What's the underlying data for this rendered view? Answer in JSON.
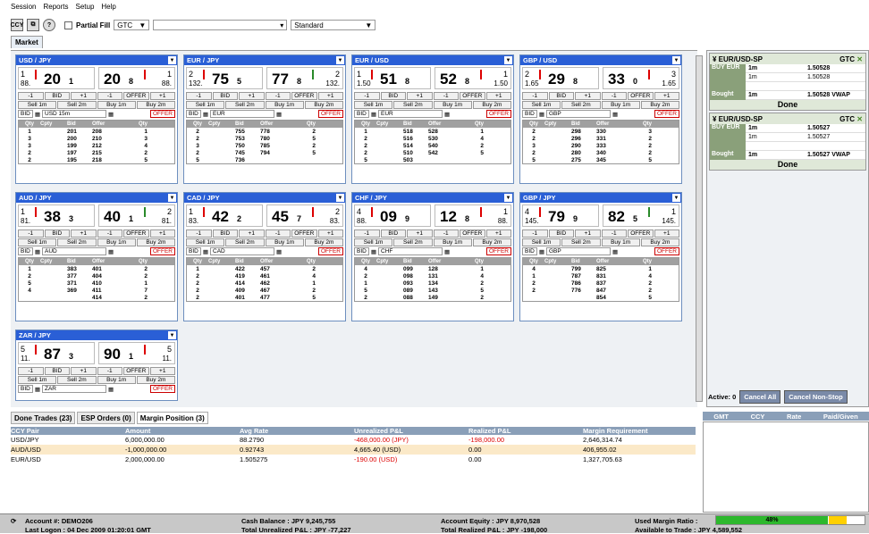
{
  "menu": [
    "Session",
    "Reports",
    "Setup",
    "Help"
  ],
  "toolbar": {
    "ccy_label": "CCY",
    "partial_fill": "Partial Fill",
    "tif": "GTC",
    "order_type": "Standard"
  },
  "main_tab": "Market",
  "panels": [
    {
      "pair": "USD / JPY",
      "bid_l": "1",
      "bid_big": "20",
      "bid_pip": "1",
      "bid_pre": "88.",
      "off_big": "20",
      "off_pip": "8",
      "off_r": "1",
      "off_pre": "88.",
      "ccy": "USD",
      "amount": "15m",
      "rows": [
        [
          "1",
          "201",
          "208",
          "1"
        ],
        [
          "3",
          "200",
          "210",
          "3"
        ],
        [
          "3",
          "199",
          "212",
          "4"
        ],
        [
          "2",
          "197",
          "215",
          "2"
        ],
        [
          "2",
          "195",
          "218",
          "5"
        ]
      ]
    },
    {
      "pair": "EUR / JPY",
      "bid_l": "2",
      "bid_big": "75",
      "bid_pip": "5",
      "bid_pre": "132.",
      "off_big": "77",
      "off_pip": "8",
      "off_r": "2",
      "off_pre": "132.",
      "ccy": "EUR",
      "amount": "",
      "rows": [
        [
          "2",
          "755",
          "778",
          "2"
        ],
        [
          "2",
          "753",
          "780",
          "5"
        ],
        [
          "3",
          "750",
          "785",
          "2"
        ],
        [
          "2",
          "745",
          "794",
          "5"
        ],
        [
          "5",
          "736",
          "",
          ""
        ]
      ]
    },
    {
      "pair": "EUR / USD",
      "bid_l": "1",
      "bid_big": "51",
      "bid_pip": "8",
      "bid_pre": "1.50",
      "off_big": "52",
      "off_pip": "8",
      "off_r": "1",
      "off_pre": "1.50",
      "ccy": "EUR",
      "amount": "",
      "rows": [
        [
          "1",
          "518",
          "528",
          "1"
        ],
        [
          "2",
          "516",
          "530",
          "4"
        ],
        [
          "2",
          "514",
          "540",
          "2"
        ],
        [
          "2",
          "510",
          "542",
          "5"
        ],
        [
          "5",
          "503",
          "",
          ""
        ]
      ]
    },
    {
      "pair": "GBP / USD",
      "bid_l": "2",
      "bid_big": "29",
      "bid_pip": "8",
      "bid_pre": "1.65",
      "off_big": "33",
      "off_pip": "0",
      "off_r": "3",
      "off_pre": "1.65",
      "ccy": "GBP",
      "amount": "",
      "rows": [
        [
          "2",
          "298",
          "330",
          "3"
        ],
        [
          "2",
          "296",
          "331",
          "2"
        ],
        [
          "3",
          "290",
          "333",
          "2"
        ],
        [
          "2",
          "280",
          "340",
          "2"
        ],
        [
          "5",
          "275",
          "345",
          "5"
        ]
      ]
    },
    {
      "pair": "AUD / JPY",
      "bid_l": "1",
      "bid_big": "38",
      "bid_pip": "3",
      "bid_pre": "81.",
      "off_big": "40",
      "off_pip": "1",
      "off_r": "2",
      "off_pre": "81.",
      "ccy": "AUD",
      "amount": "",
      "rows": [
        [
          "1",
          "383",
          "401",
          "2"
        ],
        [
          "2",
          "377",
          "404",
          "2"
        ],
        [
          "5",
          "371",
          "410",
          "1"
        ],
        [
          "4",
          "369",
          "411",
          "7"
        ],
        [
          "",
          "",
          "414",
          "2"
        ]
      ]
    },
    {
      "pair": "CAD / JPY",
      "bid_l": "1",
      "bid_big": "42",
      "bid_pip": "2",
      "bid_pre": "83.",
      "off_big": "45",
      "off_pip": "7",
      "off_r": "2",
      "off_pre": "83.",
      "ccy": "CAD",
      "amount": "",
      "rows": [
        [
          "1",
          "422",
          "457",
          "2"
        ],
        [
          "2",
          "419",
          "461",
          "4"
        ],
        [
          "2",
          "414",
          "462",
          "1"
        ],
        [
          "2",
          "409",
          "467",
          "2"
        ],
        [
          "2",
          "401",
          "477",
          "5"
        ]
      ]
    },
    {
      "pair": "CHF / JPY",
      "bid_l": "4",
      "bid_big": "09",
      "bid_pip": "9",
      "bid_pre": "88.",
      "off_big": "12",
      "off_pip": "8",
      "off_r": "1",
      "off_pre": "88.",
      "ccy": "CHF",
      "amount": "",
      "rows": [
        [
          "4",
          "099",
          "128",
          "1"
        ],
        [
          "2",
          "098",
          "131",
          "4"
        ],
        [
          "1",
          "093",
          "134",
          "2"
        ],
        [
          "5",
          "089",
          "143",
          "5"
        ],
        [
          "2",
          "088",
          "149",
          "2"
        ]
      ]
    },
    {
      "pair": "GBP / JPY",
      "bid_l": "4",
      "bid_big": "79",
      "bid_pip": "9",
      "bid_pre": "145.",
      "off_big": "82",
      "off_pip": "5",
      "off_r": "1",
      "off_pre": "145.",
      "ccy": "GBP",
      "amount": "",
      "rows": [
        [
          "4",
          "799",
          "825",
          "1"
        ],
        [
          "1",
          "787",
          "831",
          "4"
        ],
        [
          "2",
          "786",
          "837",
          "2"
        ],
        [
          "2",
          "776",
          "847",
          "2"
        ],
        [
          "",
          "",
          "854",
          "5"
        ]
      ]
    },
    {
      "pair": "ZAR / JPY",
      "bid_l": "5",
      "bid_big": "87",
      "bid_pip": "3",
      "bid_pre": "11.",
      "off_big": "90",
      "off_pip": "1",
      "off_r": "5",
      "off_pre": "11.",
      "ccy": "ZAR",
      "amount": "",
      "rows": []
    }
  ],
  "panel_labels": {
    "minus": "-1",
    "bid": "BID",
    "plus": "+1",
    "offer": "OFFER",
    "sell1": "Sell 1m",
    "sell2": "Sell 2m",
    "buy1": "Buy 1m",
    "buy2": "Buy 2m",
    "bid_sel": "BID",
    "offer_sel": "OFFER",
    "h_qty": "Qty",
    "h_cpty": "Cpty",
    "h_bid": "Bid",
    "h_offer": "Offer",
    "h_qty2": "Qty"
  },
  "esp": [
    {
      "title": "EUR/USD-SP",
      "tif": "GTC",
      "side": "BUY EUR",
      "r1_amt": "1m",
      "r1_rate": "1.50528",
      "r2_amt": "1m",
      "r2_rate": "1.50528",
      "bought": "Bought",
      "b_amt": "1m",
      "b_rate": "1.50528 VWAP",
      "done": "Done"
    },
    {
      "title": "EUR/USD-SP",
      "tif": "GTC",
      "side": "BUY EUR",
      "r1_amt": "1m",
      "r1_rate": "1.50527",
      "r2_amt": "1m",
      "r2_rate": "1.50527",
      "bought": "Bought",
      "b_amt": "1m",
      "b_rate": "1.50527 VWAP",
      "done": "Done"
    }
  ],
  "active": {
    "label": "Active: 0",
    "cancel_all": "Cancel All",
    "cancel_non": "Cancel Non-Stop"
  },
  "bottom_tabs": [
    "Done Trades (23)",
    "ESP Orders (0)",
    "Margin Position (3)"
  ],
  "positions": {
    "headers": [
      "CCY Pair",
      "Amount",
      "Avg Rate",
      "Unrealized P&L",
      "Realized P&L",
      "Margin Requirement"
    ],
    "rows": [
      [
        "USD/JPY",
        "6,000,000.00",
        "88.2790",
        "-468,000.00 (JPY)",
        "-198,000.00",
        "2,646,314.74"
      ],
      [
        "AUD/USD",
        "-1,000,000.00",
        "0.92743",
        "4,665.40 (USD)",
        "0.00",
        "406,955.02"
      ],
      [
        "EUR/USD",
        "2,000,000.00",
        "1.505275",
        "-190.00 (USD)",
        "0.00",
        "1,327,705.63"
      ]
    ]
  },
  "gmt_headers": [
    "GMT",
    "CCY",
    "Rate",
    "Paid/Given"
  ],
  "status": {
    "account": "Account #:  DEMO206",
    "logon": "Last Logon :  04 Dec 2009 01:20:01 GMT",
    "cash": "Cash Balance :  JPY 9,245,755",
    "upl": "Total Unrealized P&L :  JPY -77,227",
    "equity": "Account Equity :  JPY 8,970,528",
    "rpl": "Total Realized P&L :  JPY -198,000",
    "margin": "Used Margin Ratio :",
    "ratio": "48%",
    "available": "Available to Trade :  JPY 4,589,552"
  }
}
